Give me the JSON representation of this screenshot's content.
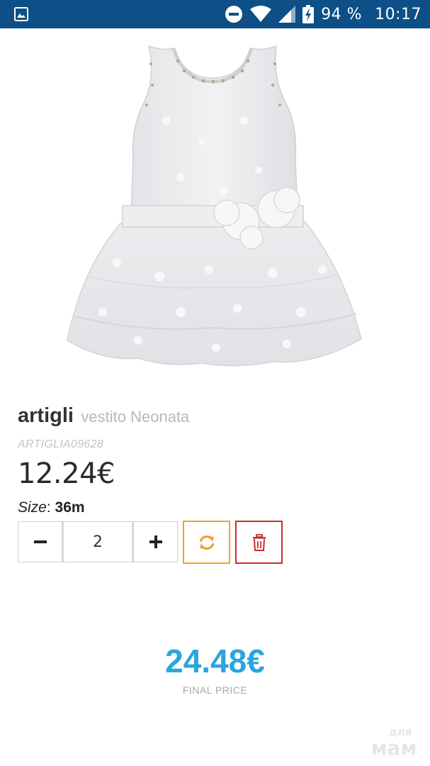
{
  "status_bar": {
    "battery": "94 %",
    "time": "10:17"
  },
  "product": {
    "brand": "artigli",
    "name": "vestito Neonata",
    "sku": "ARTIGLIA09628",
    "unit_price": "12.24€",
    "size_label": "Size",
    "size_separator": ": ",
    "size_value": "36m",
    "quantity": "2",
    "image_icon": "white-dress-image"
  },
  "summary": {
    "final_price": "24.48€",
    "final_label": "FINAL PRICE"
  },
  "watermark": {
    "text_top": "для",
    "text_bottom": "мам"
  },
  "colors": {
    "status_bar_bg": "#0d4f86",
    "update_button": "#f0a22a",
    "delete_button": "#cc2b2b",
    "final_price": "#2aa5df"
  }
}
